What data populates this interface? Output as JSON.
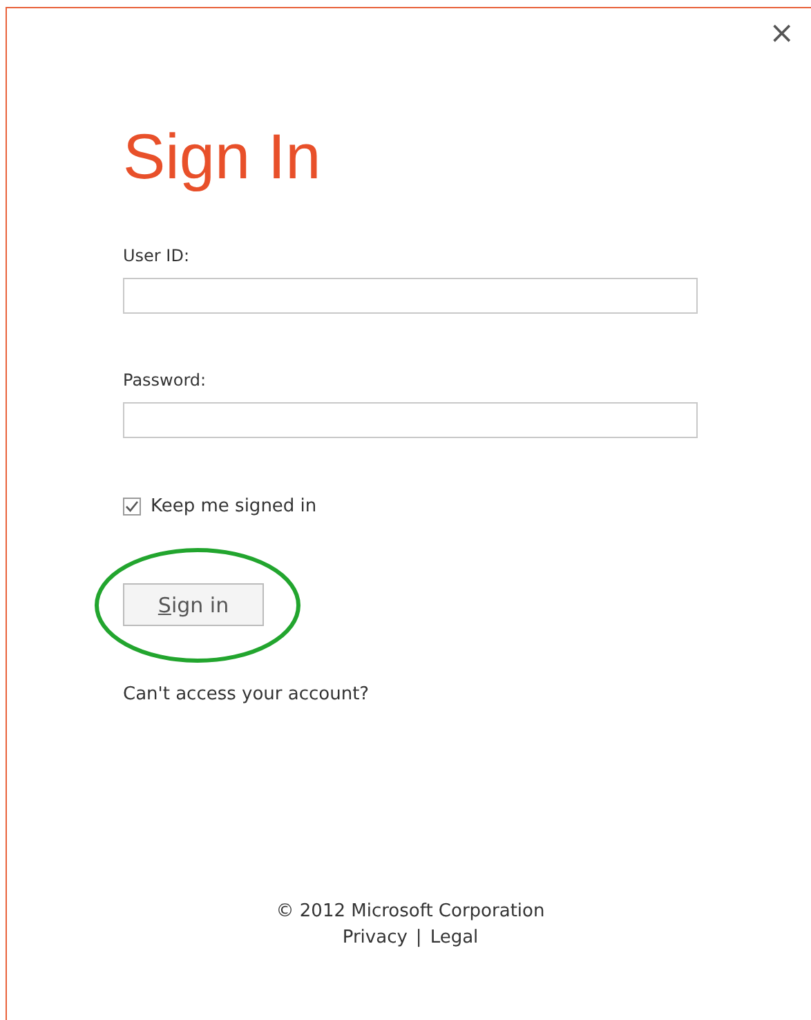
{
  "dialog": {
    "title": "Sign In",
    "close": "×"
  },
  "fields": [
    {
      "label": "User ID:"
    },
    {
      "label": "Password:"
    }
  ],
  "keep_signed_in": {
    "label": "Keep me signed in",
    "checked": true
  },
  "sign_in_button": {
    "label": "Sign in",
    "highlighted": true
  },
  "help_link": "Can't access your account?",
  "footer": {
    "copyright": "© 2012 Microsoft Corporation",
    "links": [
      "Privacy",
      "Legal"
    ],
    "separator": "|"
  }
}
